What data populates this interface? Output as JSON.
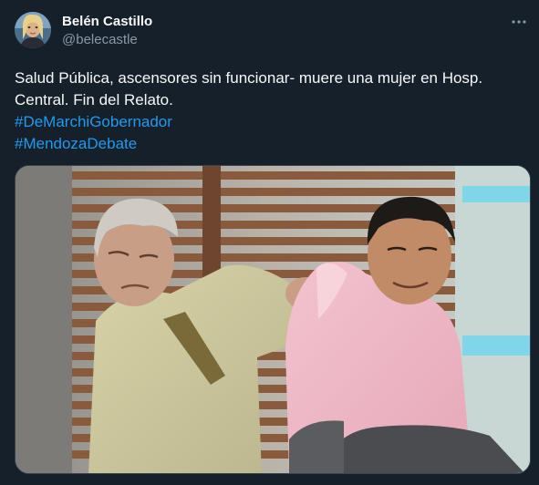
{
  "tweet": {
    "author": {
      "display_name": "Belén Castillo",
      "handle": "@belecastle",
      "avatar_icon": "profile-photo"
    },
    "more_icon": "more-horizontal-icon",
    "text_lines": [
      "Salud Pública, ascensores sin funcionar- muere una mujer en Hosp.",
      "Central. Fin del Relato."
    ],
    "hashtags": [
      "#DeMarchiGobernador",
      "#MendozaDebate"
    ],
    "media": {
      "type": "photo"
    }
  },
  "colors": {
    "background": "#15202b",
    "text": "#f7f9f9",
    "secondary_text": "#8b98a5",
    "link": "#1d9bf0",
    "border": "#38444d"
  }
}
